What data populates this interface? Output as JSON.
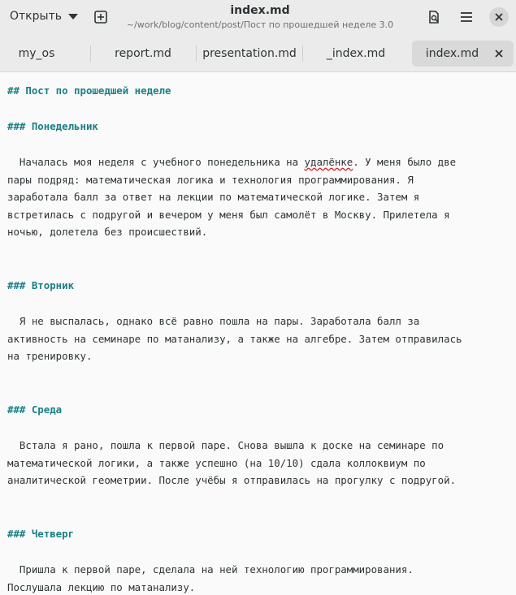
{
  "header": {
    "open_label": "Открыть",
    "title": "index.md",
    "subtitle": "~/work/blog/content/post/Пост по прошедшей неделе 3.0"
  },
  "tabs": [
    {
      "label": "my_os"
    },
    {
      "label": "report.md"
    },
    {
      "label": "presentation.md"
    },
    {
      "label": "_index.md"
    },
    {
      "label": "index.md",
      "active": true
    }
  ],
  "doc": {
    "h2": "## Пост по прошедшей неделе",
    "h_mon": "### Понедельник",
    "mon1_a": "  Началась моя неделя с учебного понедельника на ",
    "mon1_word": "удалёнке",
    "mon1_b": ". У меня было две",
    "mon2": "пары подряд: математическая логика и технология программирования. Я",
    "mon3": "заработала балл за ответ на лекции по математической логике. Затем я",
    "mon4": "встретилась с подругой и вечером у меня был самолёт в Москву. Прилетела я",
    "mon5": "ночью, долетела без происшествий.",
    "h_tue": "### Вторник",
    "tue1": "  Я не выспалась, однако всё равно пошла на пары. Заработала балл за",
    "tue2": "активность на семинаре по матанализу, а также на алгебре. Затем отправилась",
    "tue3": "на тренировку.",
    "h_wed": "### Среда",
    "wed1": "  Встала я рано, пошла к первой паре. Снова вышла к доске на семинаре по",
    "wed2": "математической логики, а также успешно (на 10/10) сдала коллоквиум по",
    "wed3": "аналитической геометрии. После учёбы я отправилась на прогулку с подругой.",
    "h_thu": "### Четверг",
    "thu1": "  Пришла к первой паре, сделала на ней технологию программирования.",
    "thu2": "Послушала лекцию по матанализу."
  }
}
